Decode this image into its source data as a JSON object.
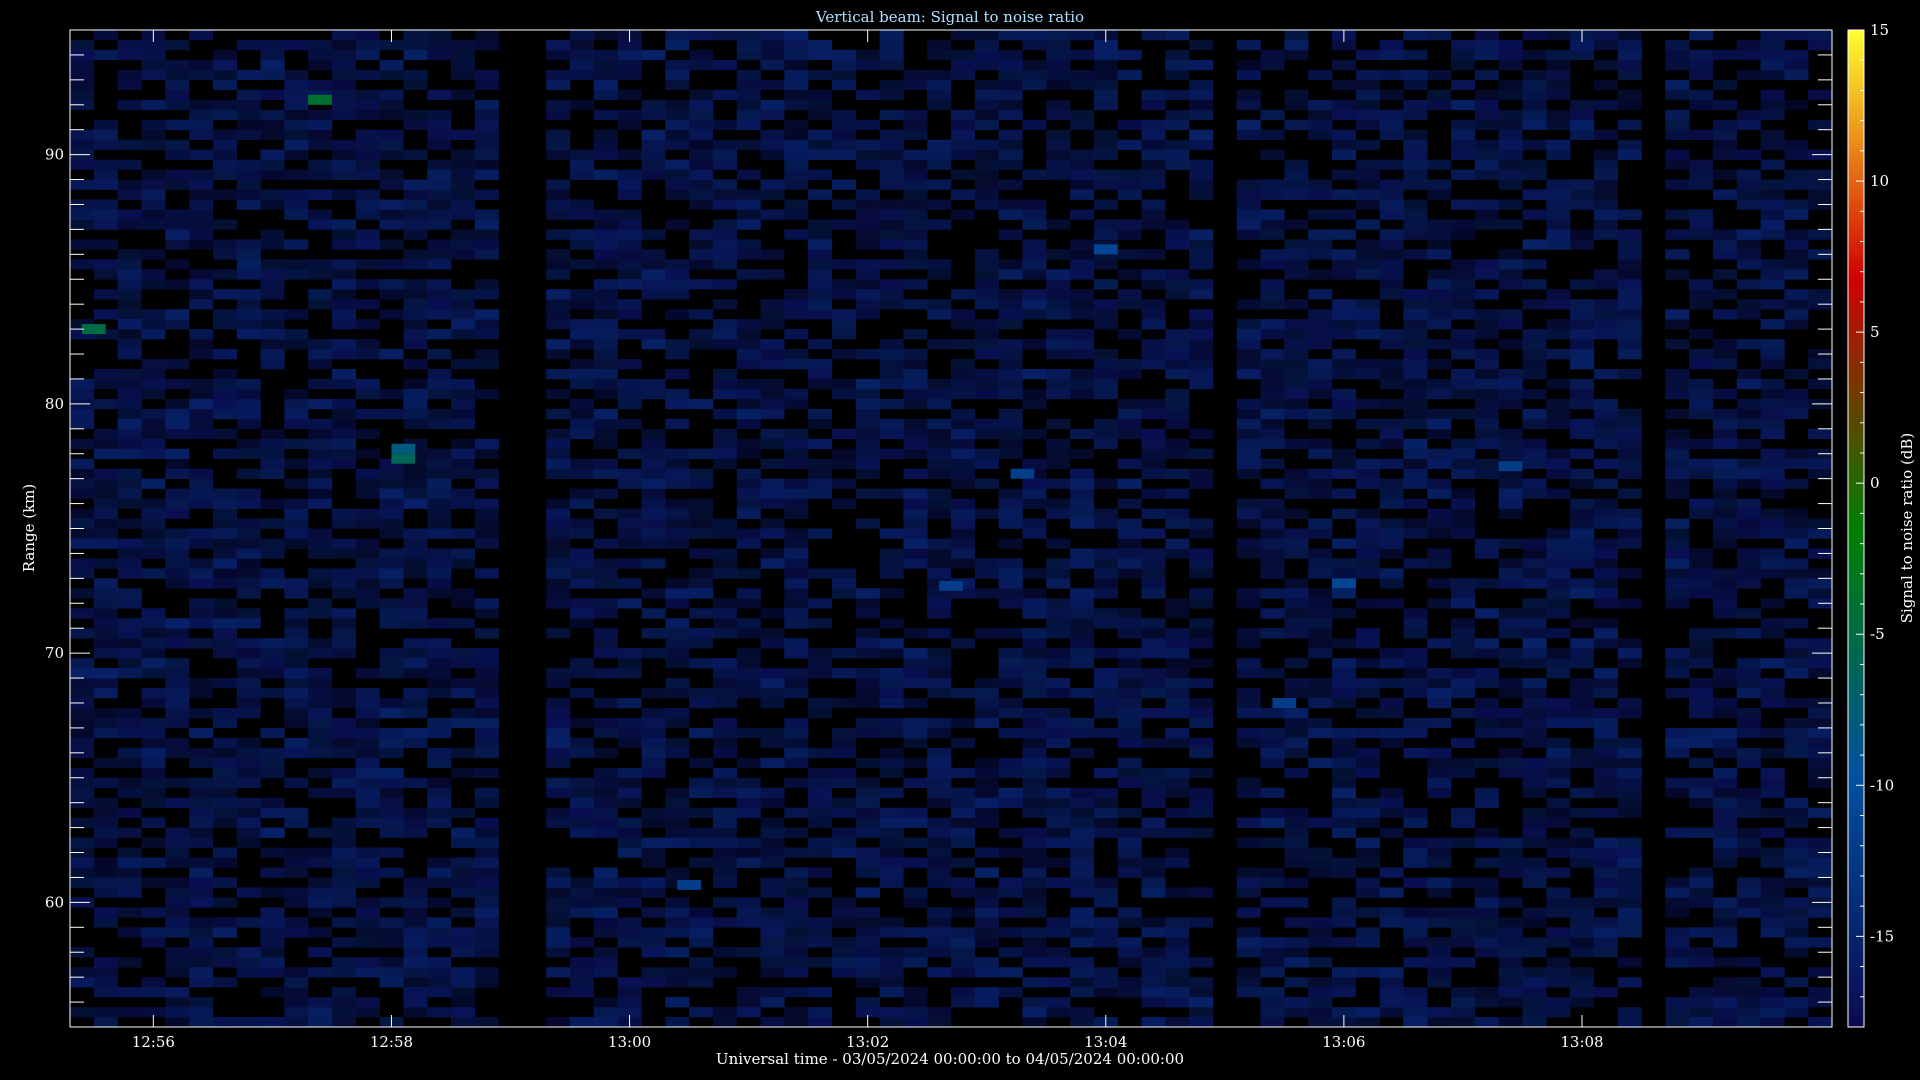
{
  "chart_data": {
    "type": "heatmap",
    "title": "Vertical beam: Signal to noise ratio",
    "xlabel": "Universal time - 03/05/2024 00:00:00 to 04/05/2024 00:00:00",
    "ylabel": "Range (km)",
    "colorbar_label": "Signal to noise ratio (dB)",
    "x_range_minutes": [
      775.3,
      790.1
    ],
    "ylim": [
      55,
      95
    ],
    "x_ticks": [
      {
        "minute": 776,
        "label": "12:56"
      },
      {
        "minute": 778,
        "label": "12:58"
      },
      {
        "minute": 780,
        "label": "13:00"
      },
      {
        "minute": 782,
        "label": "13:02"
      },
      {
        "minute": 784,
        "label": "13:04"
      },
      {
        "minute": 786,
        "label": "13:06"
      },
      {
        "minute": 788,
        "label": "13:08"
      }
    ],
    "y_ticks": [
      60,
      70,
      80,
      90
    ],
    "colorbar_range": [
      -18,
      15
    ],
    "colorbar_ticks": [
      15,
      10,
      5,
      0,
      -5,
      -10,
      -15
    ],
    "background_level_db": -16,
    "data_gaps_minutes": [
      [
        778.85,
        779.25
      ],
      [
        784.85,
        785.05
      ],
      [
        788.6,
        788.75
      ]
    ],
    "range_resolution_km": 0.4,
    "time_step_minutes": 0.2,
    "colormap": [
      "#0a0a50",
      "#0050a0",
      "#008000",
      "#d00000",
      "#ffff30"
    ],
    "highlights": [
      {
        "minute": 777.3,
        "range_km": 92.0,
        "snr_db": -4
      },
      {
        "minute": 775.4,
        "range_km": 82.8,
        "snr_db": -5
      },
      {
        "minute": 778.0,
        "range_km": 78.0,
        "snr_db": -8
      },
      {
        "minute": 778.0,
        "range_km": 77.6,
        "snr_db": -6
      },
      {
        "minute": 783.9,
        "range_km": 86.0,
        "snr_db": -11
      },
      {
        "minute": 785.9,
        "range_km": 72.6,
        "snr_db": -11
      },
      {
        "minute": 783.2,
        "range_km": 77.0,
        "snr_db": -12
      },
      {
        "minute": 782.6,
        "range_km": 72.5,
        "snr_db": -12
      },
      {
        "minute": 785.4,
        "range_km": 67.8,
        "snr_db": -12
      },
      {
        "minute": 787.3,
        "range_km": 77.3,
        "snr_db": -12
      },
      {
        "minute": 780.4,
        "range_km": 60.5,
        "snr_db": -12
      }
    ]
  }
}
